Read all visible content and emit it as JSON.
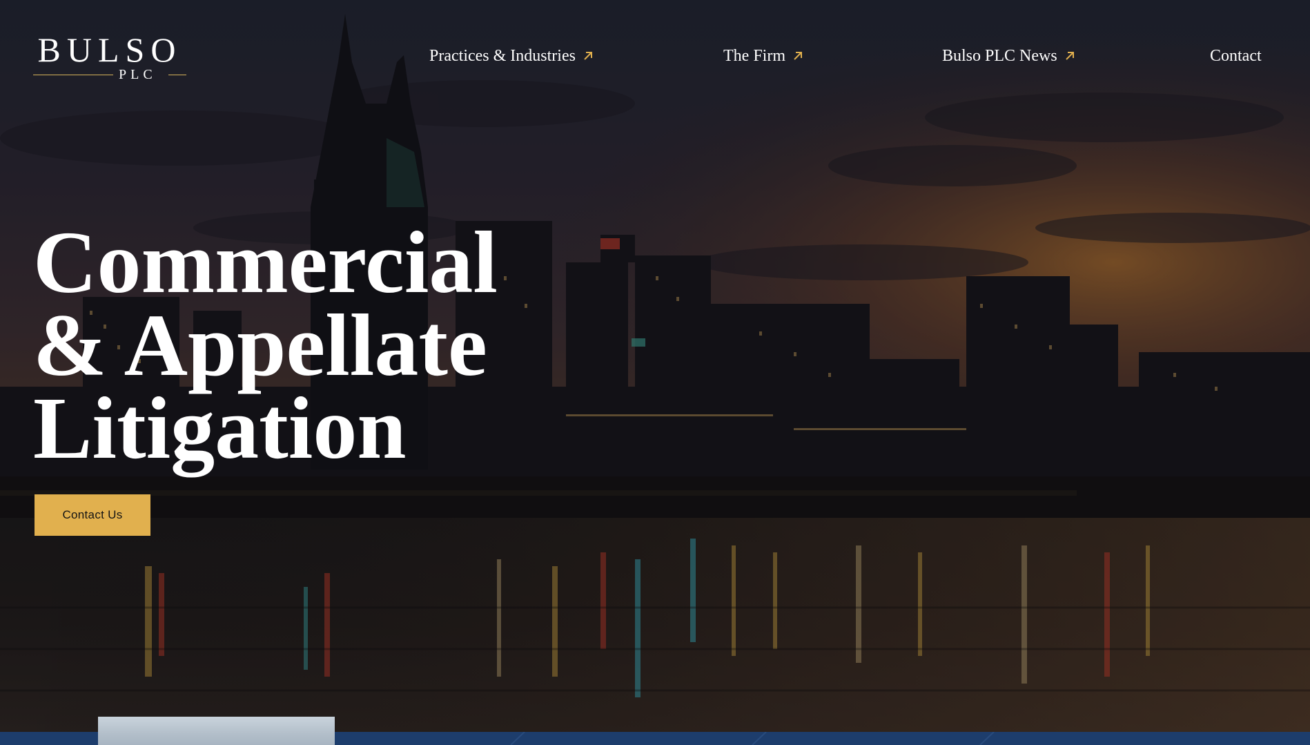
{
  "header": {
    "logo": {
      "main": "BULSO",
      "sub": "PLC"
    },
    "nav": [
      {
        "label": "Practices & Industries",
        "icon": "arrow-up-right-icon"
      },
      {
        "label": "The Firm",
        "icon": "arrow-up-right-icon"
      },
      {
        "label": "Bulso PLC News",
        "icon": "arrow-up-right-icon"
      },
      {
        "label": "Contact"
      }
    ]
  },
  "hero": {
    "title_lines": [
      "Commercial",
      "& Appellate",
      "Litigation"
    ],
    "cta_label": "Contact Us",
    "background": "nashville-skyline-dusk-photo"
  },
  "colors": {
    "accent_gold": "#e1b04e",
    "logo_rule_gold": "#d6b35a",
    "text": "#ffffff",
    "band_navy": "#1d3d6c"
  }
}
